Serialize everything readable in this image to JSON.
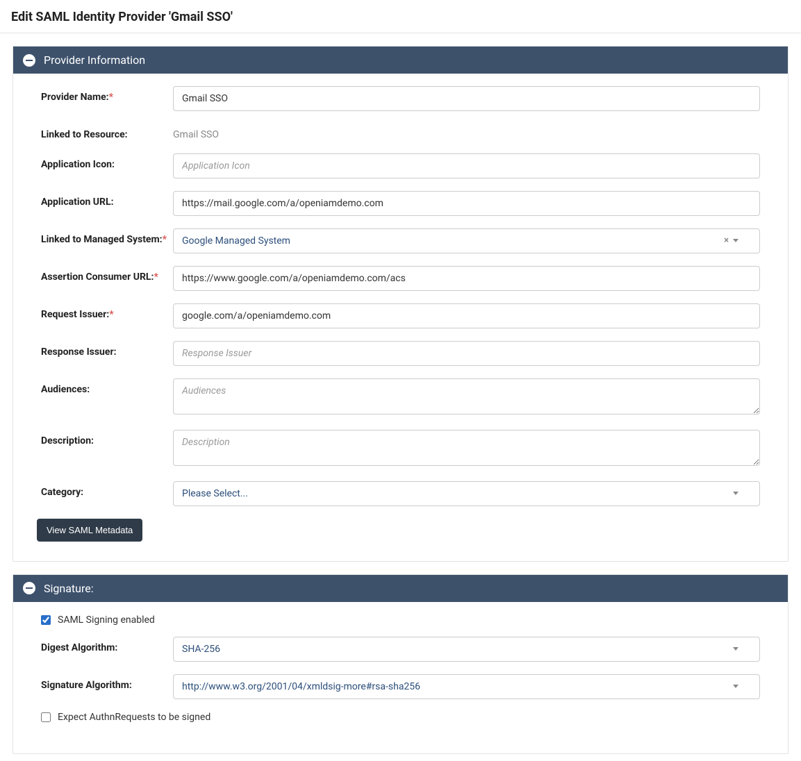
{
  "header": {
    "title": "Edit SAML Identity Provider 'Gmail SSO'"
  },
  "providerInfo": {
    "panel_title": "Provider Information",
    "providerName": {
      "label": "Provider Name:",
      "value": "Gmail SSO",
      "required": true
    },
    "linkedResource": {
      "label": "Linked to Resource:",
      "value": "Gmail SSO"
    },
    "appIcon": {
      "label": "Application Icon:",
      "value": "",
      "placeholder": "Application Icon"
    },
    "appUrl": {
      "label": "Application URL:",
      "value": "https://mail.google.com/a/openiamdemo.com"
    },
    "linkedManaged": {
      "label": "Linked to Managed System:",
      "value": "Google Managed System",
      "required": true
    },
    "acsUrl": {
      "label": "Assertion Consumer URL:",
      "value": "https://www.google.com/a/openiamdemo.com/acs",
      "required": true
    },
    "requestIssuer": {
      "label": "Request Issuer:",
      "value": "google.com/a/openiamdemo.com",
      "required": true
    },
    "responseIssuer": {
      "label": "Response Issuer:",
      "value": "",
      "placeholder": "Response Issuer"
    },
    "audiences": {
      "label": "Audiences:",
      "value": "",
      "placeholder": "Audiences"
    },
    "description": {
      "label": "Description:",
      "value": "",
      "placeholder": "Description"
    },
    "category": {
      "label": "Category:",
      "value": "Please Select..."
    },
    "viewMetadata": "View SAML Metadata"
  },
  "signature": {
    "panel_title": "Signature:",
    "signingEnabled": {
      "label": "SAML Signing enabled",
      "checked": true
    },
    "digestAlg": {
      "label": "Digest Algorithm:",
      "value": "SHA-256"
    },
    "sigAlg": {
      "label": "Signature Algorithm:",
      "value": "http://www.w3.org/2001/04/xmldsig-more#rsa-sha256"
    },
    "expectSigned": {
      "label": "Expect AuthnRequests to be signed",
      "checked": false
    }
  }
}
